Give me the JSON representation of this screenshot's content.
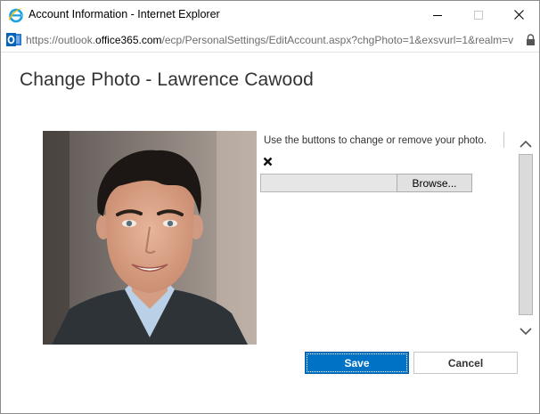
{
  "window": {
    "title": "Account Information - Internet Explorer",
    "icons": {
      "app": "internet-explorer-icon",
      "minimize": "minimize-icon",
      "maximize": "maximize-icon",
      "close": "close-icon"
    }
  },
  "address_bar": {
    "url_prefix": "https://outlook.",
    "url_host": "office365.com",
    "url_rest": "/ecp/PersonalSettings/EditAccount.aspx?chgPhoto=1&exsvurl=1&realm=v",
    "site_icon": "outlook-icon",
    "security_icon": "lock-icon"
  },
  "page": {
    "title": "Change Photo - Lawrence Cawood",
    "photo_alt": "profile-photo",
    "instruction": "Use the buttons to change or remove your photo.",
    "remove_icon": "remove-x-icon",
    "file_input_value": "",
    "browse_label": "Browse...",
    "save_label": "Save",
    "cancel_label": "Cancel"
  },
  "colors": {
    "accent": "#0072c6",
    "title_text": "#333333",
    "ie_blue": "#1ba1e2"
  }
}
